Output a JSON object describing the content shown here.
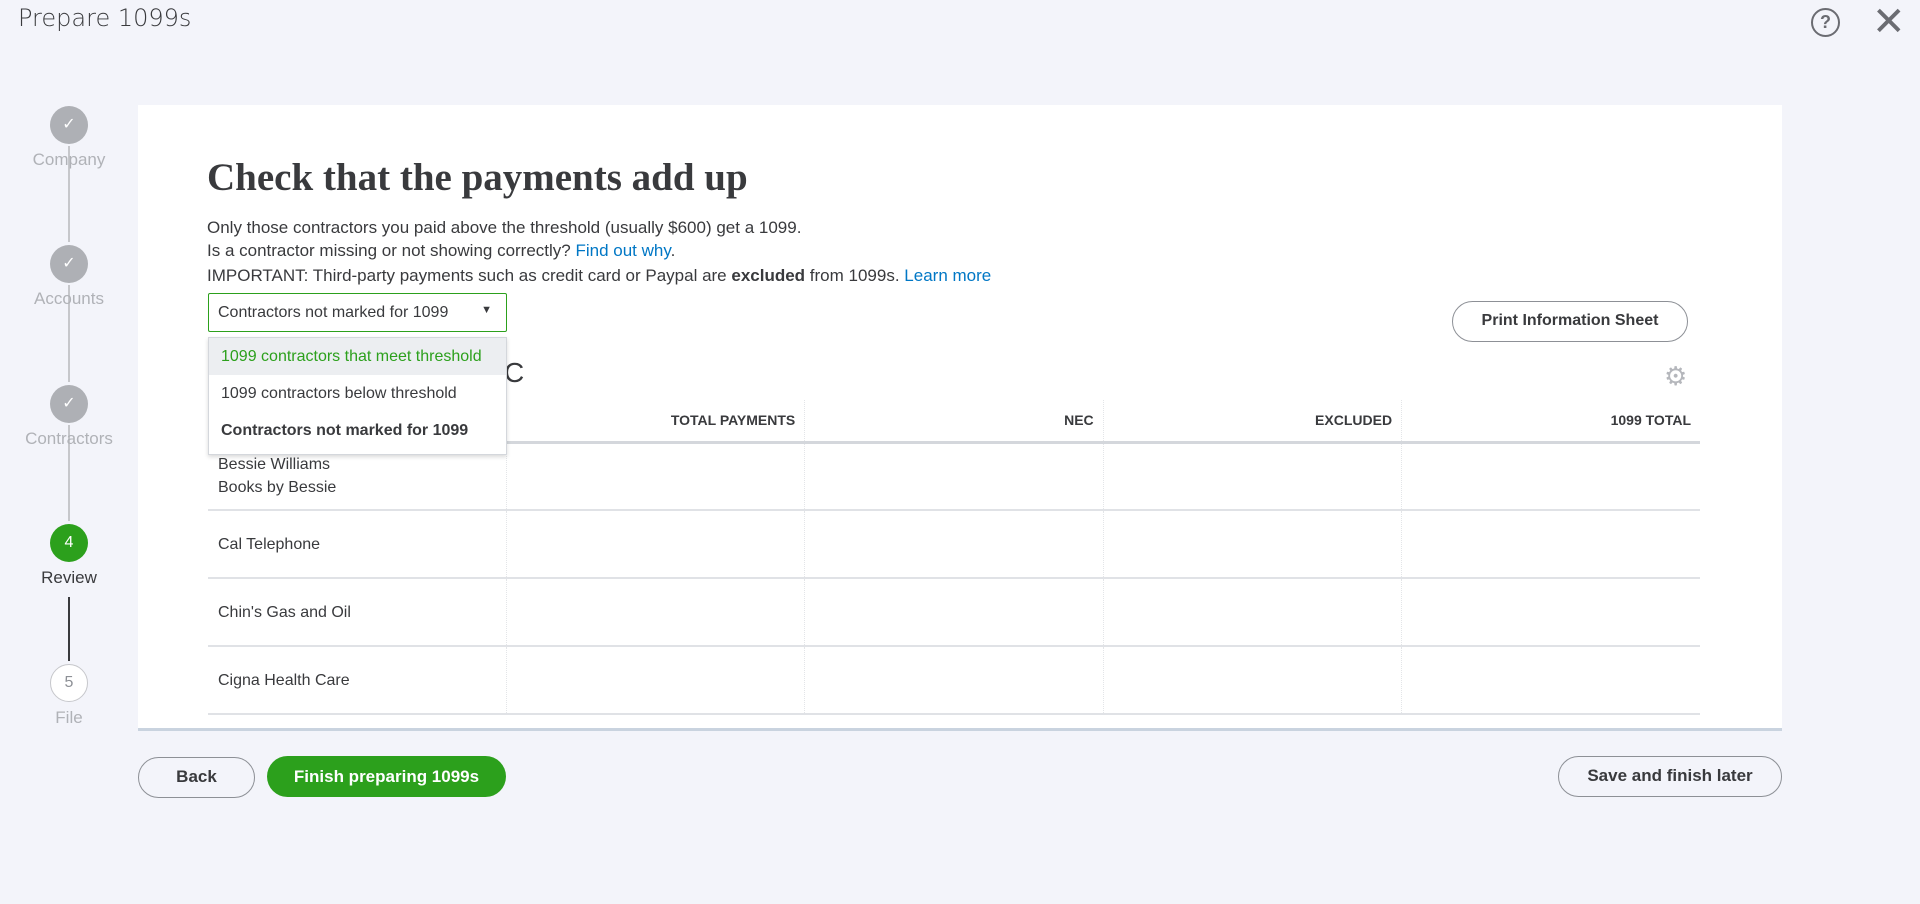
{
  "header": {
    "title": "Prepare 1099s",
    "help_icon": "question-circle-icon",
    "close_icon": "close-x-icon"
  },
  "stepper": [
    {
      "label": "Company",
      "state": "done",
      "mark": "✓"
    },
    {
      "label": "Accounts",
      "state": "done",
      "mark": "✓"
    },
    {
      "label": "Contractors",
      "state": "done",
      "mark": "✓"
    },
    {
      "label": "Review",
      "state": "active",
      "mark": "4"
    },
    {
      "label": "File",
      "state": "future",
      "mark": "5"
    }
  ],
  "main": {
    "heading": "Check that the payments add up",
    "line1": "Only those contractors you paid above the threshold (usually $600) get a 1099.",
    "line2_text": "Is a contractor missing or not showing correctly? ",
    "line2_link": "Find out why",
    "line2_end": ".",
    "line3_a": "IMPORTANT: Third-party payments such as credit card or Paypal are ",
    "line3_bold": "excluded",
    "line3_b": " from 1099s. ",
    "line3_link": "Learn more",
    "filter_value": "Contractors not marked for 1099",
    "filter_options": [
      "1099 contractors that meet threshold",
      "1099 contractors below threshold",
      "Contractors not marked for 1099"
    ],
    "section_partial": "C",
    "print_label": "Print Information Sheet",
    "columns": [
      "",
      "TOTAL PAYMENTS",
      "NEC",
      "EXCLUDED",
      "1099 TOTAL"
    ],
    "rows": [
      {
        "name": "Bessie Williams",
        "sub": "Books by Bessie"
      },
      {
        "name": "Cal Telephone",
        "sub": ""
      },
      {
        "name": "Chin's Gas and Oil",
        "sub": ""
      },
      {
        "name": "Cigna Health Care",
        "sub": ""
      }
    ]
  },
  "footer": {
    "back": "Back",
    "finish": "Finish preparing 1099s",
    "save": "Save and finish later"
  },
  "colors": {
    "brand_green": "#2ca01c",
    "link_blue": "#0077c5"
  }
}
